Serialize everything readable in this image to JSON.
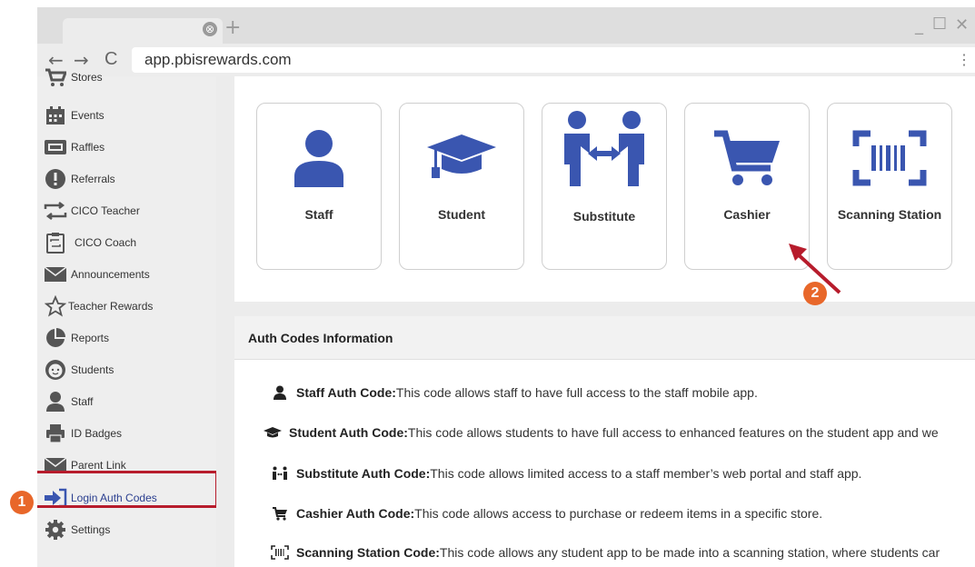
{
  "browser": {
    "tab_close": "⊗",
    "tab_new": "+",
    "controls": {
      "minimize": "_",
      "maximize": "☐",
      "close": "✕"
    },
    "nav": {
      "back": "←",
      "forward": "→",
      "reload": "C"
    },
    "url": "app.pbisrewards.com",
    "menu": "⋮"
  },
  "sidebar": {
    "items": [
      {
        "label": "Stores",
        "icon": "cart-icon"
      },
      {
        "label": "Events",
        "icon": "calendar-icon"
      },
      {
        "label": "Raffles",
        "icon": "ticket-icon"
      },
      {
        "label": "Referrals",
        "icon": "alert-icon"
      },
      {
        "label": "CICO Teacher",
        "icon": "exchange-icon"
      },
      {
        "label": "CICO Coach",
        "icon": "clipboard-icon"
      },
      {
        "label": "Announcements",
        "icon": "envelope-icon"
      },
      {
        "label": "Teacher Rewards",
        "icon": "star-icon"
      },
      {
        "label": "Reports",
        "icon": "pie-chart-icon"
      },
      {
        "label": "Students",
        "icon": "smiley-icon"
      },
      {
        "label": "Staff",
        "icon": "person-icon"
      },
      {
        "label": "ID Badges",
        "icon": "printer-icon"
      },
      {
        "label": "Parent Link",
        "icon": "envelope-icon"
      },
      {
        "label": "Login Auth Codes",
        "icon": "sign-in-icon"
      },
      {
        "label": "Settings",
        "icon": "gear-icon"
      }
    ],
    "active_color": "#3a56b0"
  },
  "tiles": [
    {
      "label": "Staff",
      "icon": "person-icon"
    },
    {
      "label": "Student",
      "icon": "graduation-cap-icon"
    },
    {
      "label": "Substitute",
      "icon": "substitute-icon"
    },
    {
      "label": "Cashier",
      "icon": "cart-icon"
    },
    {
      "label": "Scanning Station",
      "icon": "barcode-icon"
    }
  ],
  "info": {
    "header": "Auth Codes Information",
    "rows": [
      {
        "title": "Staff Auth Code:",
        "text": " This code allows staff to have full access to the staff mobile app.",
        "icon": "person-icon"
      },
      {
        "title": "Student Auth Code:",
        "text": " This code allows students to have full access to enhanced features on the student app and we",
        "icon": "graduation-cap-icon"
      },
      {
        "title": "Substitute Auth Code:",
        "text": "This code allows limited access to a staff member’s web portal and staff app.",
        "icon": "substitute-icon"
      },
      {
        "title": "Cashier Auth Code:",
        "text": " This code allows access to purchase or redeem items in a specific store.",
        "icon": "cart-icon"
      },
      {
        "title": "Scanning Station Code:",
        "text": " This code allows any student app to be made into a scanning station, where students car",
        "icon": "barcode-icon"
      }
    ]
  },
  "annotations": {
    "step1": "1",
    "step2": "2"
  },
  "colors": {
    "brand": "#3a56b0",
    "highlight": "#b71c2c",
    "badge": "#e8672a",
    "icon_gray": "#555555"
  }
}
